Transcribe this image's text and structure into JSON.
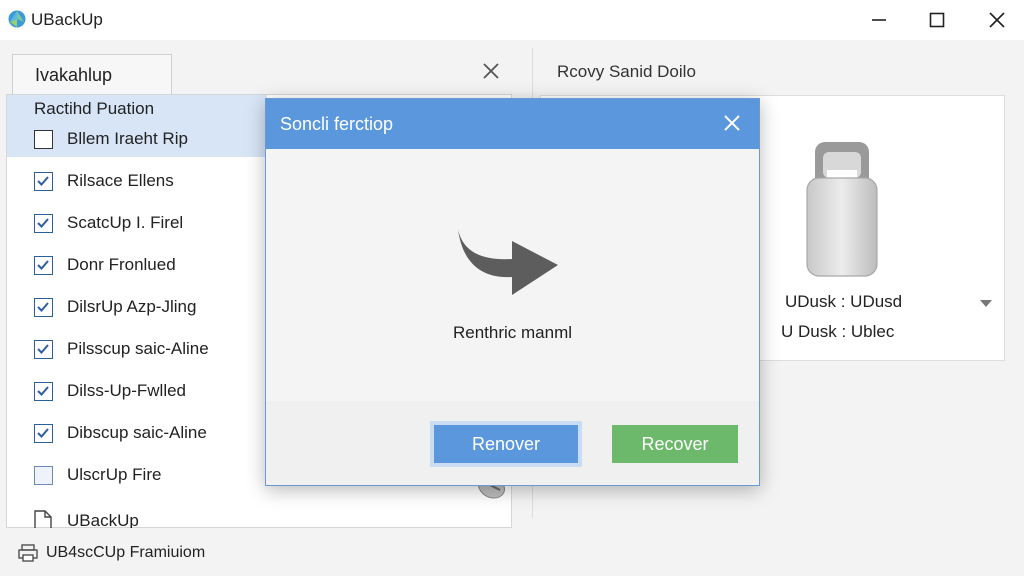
{
  "window": {
    "title": "UBackUp",
    "icon": "app-logo-icon",
    "controls": [
      "minimize-icon",
      "maximize-icon",
      "close-icon"
    ]
  },
  "left": {
    "tab_label": "Ivakahlup",
    "header_label": "Ractihd Puation",
    "items": [
      {
        "label": "Bllem Iraeht Rip",
        "checked": false
      },
      {
        "label": "Rilsace Ellens",
        "checked": true
      },
      {
        "label": "ScatcUp I. Firel",
        "checked": true
      },
      {
        "label": "Donr Fronlued",
        "checked": true
      },
      {
        "label": "DilsrUp Azp-Jling",
        "checked": true
      },
      {
        "label": "Pilsscup saic-Aline",
        "checked": true
      },
      {
        "label": "Dilss-Up-Fwlled",
        "checked": true
      },
      {
        "label": "Dibscup saic-Aline",
        "checked": true
      },
      {
        "label": "UlscrUp Fire",
        "checked": false
      }
    ],
    "footer_item": "UBackUp",
    "footer_icon": "document-icon"
  },
  "status": {
    "label": "UB4scCUp Framiuiom",
    "icon": "printer-icon"
  },
  "right": {
    "title": "Rcovy Sanid Doilo",
    "drive_line1": "UDusk : UDusd",
    "drive_line2": "U Dusk : Ublec",
    "drive_icon": "usb-drive-icon"
  },
  "dialog": {
    "title": "Soncli ferctiop",
    "message": "Renthric manml",
    "primary_button": "Renover",
    "secondary_button": "Recover",
    "icon": "arrow-right-icon"
  },
  "colors": {
    "dialog_header": "#5a97dc",
    "primary_button": "#5b97dc",
    "secondary_button": "#6cb96b",
    "selection": "#d7e5f6"
  }
}
